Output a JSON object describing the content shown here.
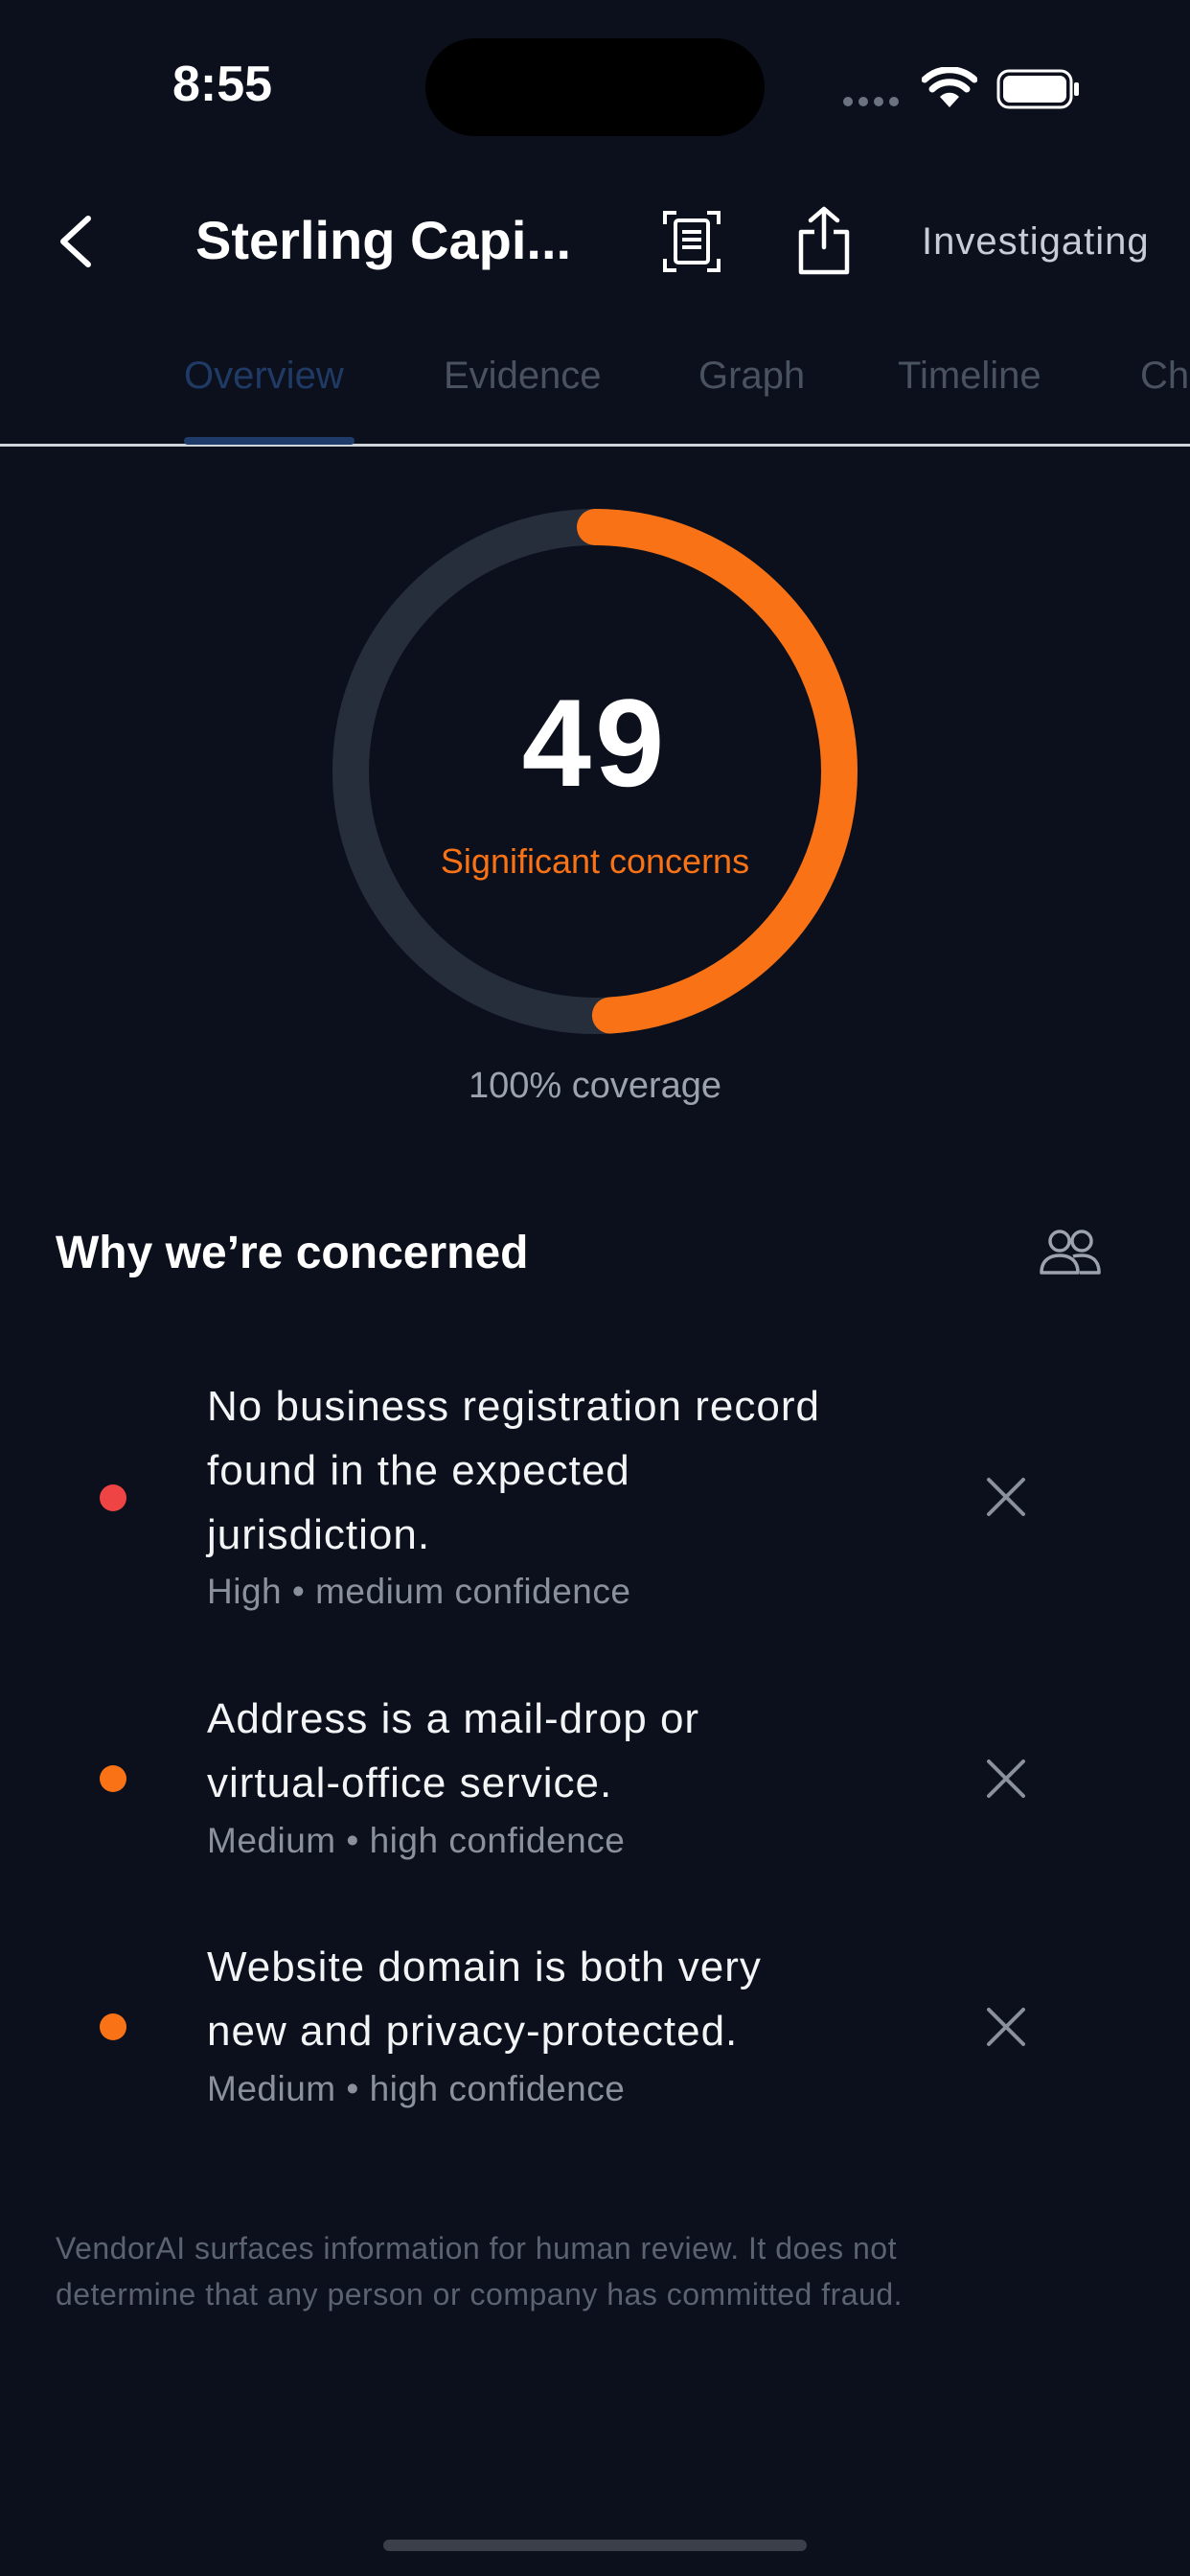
{
  "status_bar": {
    "time": "8:55"
  },
  "header": {
    "title": "Sterling Capi...",
    "status": "Investigating"
  },
  "tabs": [
    {
      "label": "Overview",
      "active": true
    },
    {
      "label": "Evidence",
      "active": false
    },
    {
      "label": "Graph",
      "active": false
    },
    {
      "label": "Timeline",
      "active": false
    },
    {
      "label": "Ch",
      "active": false
    }
  ],
  "score": {
    "value": "49",
    "label": "Significant concerns",
    "fraction": 0.49,
    "coverage": "100% coverage",
    "color": "#f97316",
    "track_color": "#272e3b"
  },
  "concerns_section": {
    "title": "Why we’re concerned",
    "items": [
      {
        "lines": [
          "No business registration record",
          "found in the expected",
          "jurisdiction."
        ],
        "meta": "High • medium confidence",
        "severity_color": "#ef4444"
      },
      {
        "lines": [
          "Address is a mail-drop or",
          "virtual-office service."
        ],
        "meta": "Medium • high confidence",
        "severity_color": "#f97316"
      },
      {
        "lines": [
          "Website domain is both very",
          "new and privacy-protected."
        ],
        "meta": "Medium • high confidence",
        "severity_color": "#f97316"
      }
    ]
  },
  "disclaimer": {
    "line1": "VendorAI surfaces information for human review. It does not",
    "line2": "determine that any person or company has committed fraud."
  },
  "icons": {
    "back": "chevron-left-icon",
    "document": "document-scan-icon",
    "share": "share-icon",
    "people": "people-icon",
    "dismiss": "close-icon"
  }
}
